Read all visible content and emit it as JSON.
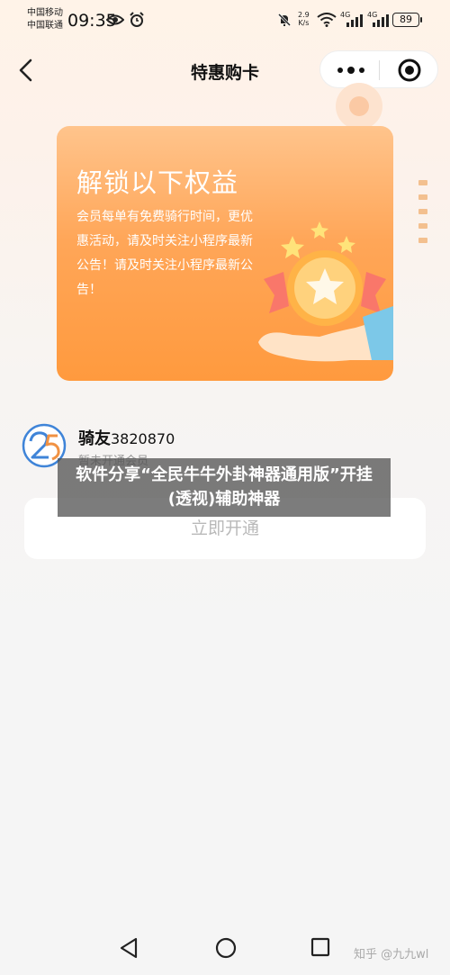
{
  "status_bar": {
    "carrier_1": "中国移动",
    "carrier_2": "中国联通",
    "time": "09:35",
    "speed_value": "2.9",
    "speed_unit": "K/s",
    "network_1": "4G",
    "network_2": "4G",
    "battery": "89",
    "icons": [
      "eye-icon",
      "alarm-icon",
      "mute-icon",
      "wifi-icon",
      "signal-icon",
      "battery-icon"
    ]
  },
  "header": {
    "title": "特惠购卡",
    "icons": [
      "back-arrow-icon",
      "more-dots-icon",
      "target-icon"
    ]
  },
  "card": {
    "title": "解锁以下权益",
    "description": "会员每单有免费骑行时间，更优惠活动，请及时关注小程序最新公告！请及时关注小程序最新公告！",
    "colors": {
      "gradient_top": "#ffc48c",
      "gradient_bottom": "#ff9a3e"
    }
  },
  "user": {
    "name": "骑友",
    "id": "3820870",
    "status": "暂未开通会员"
  },
  "actions": {
    "open_label": "立即开通"
  },
  "overlay": {
    "text": "软件分享“全民牛牛外卦神器通用版”开挂(透视)辅助神器"
  },
  "navbar": {
    "icons": [
      "back-triangle-icon",
      "home-circle-icon",
      "recents-square-icon"
    ]
  },
  "watermark": "知乎 @九九wl"
}
